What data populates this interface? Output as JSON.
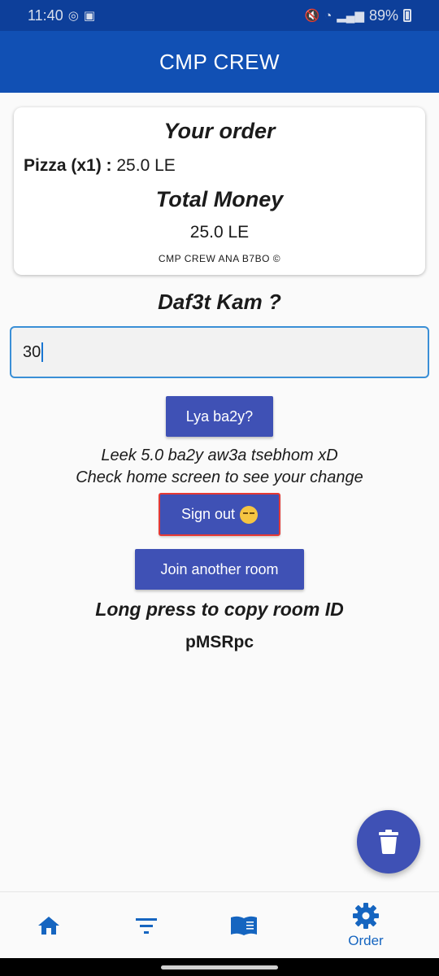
{
  "status_bar": {
    "time": "11:40",
    "battery": "89%"
  },
  "app_bar": {
    "title": "CMP CREW"
  },
  "order_card": {
    "title": "Your order",
    "item_name": "Pizza (x1) :",
    "item_price": "25.0 LE",
    "total_title": "Total Money",
    "total_value": "25.0 LE",
    "footer": "CMP CREW ANA B7BO ©"
  },
  "payment": {
    "title": "Daf3t Kam ?",
    "amount_value": "30"
  },
  "buttons": {
    "change_label": "Lya ba2y?",
    "signout_label": "Sign out",
    "join_label": "Join another room"
  },
  "change_message": {
    "line1": "Leek 5.0 ba2y aw3a tsebhom xD",
    "line2": "Check home screen to see your change"
  },
  "room": {
    "copy_hint": "Long press to copy room ID",
    "id": "pMSRpc"
  },
  "bottom_nav": {
    "items": [
      {
        "icon": "home-icon",
        "label": ""
      },
      {
        "icon": "filter-icon",
        "label": ""
      },
      {
        "icon": "menu-book-icon",
        "label": ""
      },
      {
        "icon": "gear-icon",
        "label": "Order"
      }
    ]
  },
  "colors": {
    "status_bar": "#0d3f9a",
    "app_bar": "#1150b4",
    "button": "#3f51b5",
    "nav_active": "#1565c0"
  }
}
